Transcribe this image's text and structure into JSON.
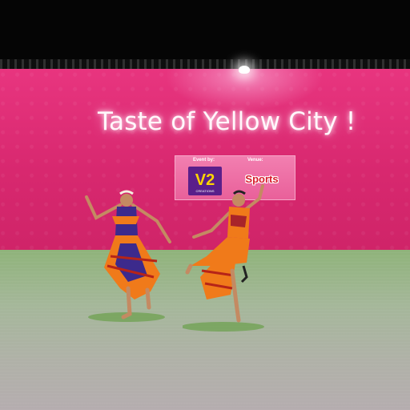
{
  "banner": {
    "title": "Taste of Yellow City !",
    "event_label": "Event by:",
    "venue_label": "Venue:",
    "organizer_logo": "V2",
    "organizer_sub": "CREATIONS",
    "venue_logo": "Sports"
  },
  "colors": {
    "backdrop": "#e8357f",
    "floor": "#a5b79a",
    "costume_orange": "#f07a1a",
    "costume_blue": "#3c2a8c"
  },
  "scene": {
    "subject": "two classical dancers"
  }
}
